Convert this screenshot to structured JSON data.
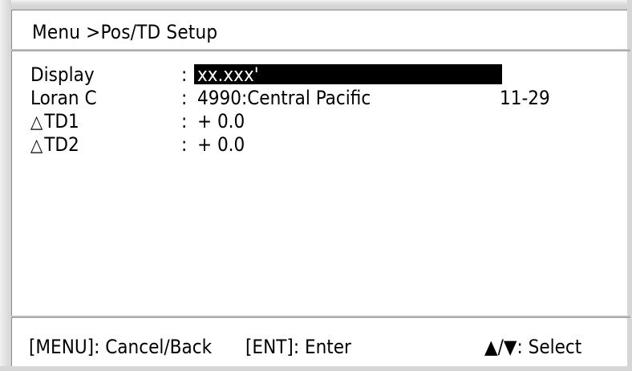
{
  "header": {
    "title": "Menu >Pos/TD Setup"
  },
  "settings": [
    {
      "label": "Display",
      "symbol": "",
      "value": "xx.xxx'",
      "extra": ""
    },
    {
      "label": "Loran C",
      "symbol": "",
      "value": "4990:Central Pacific",
      "extra": "11-29"
    },
    {
      "label": "TD1",
      "symbol": "△",
      "value": "+ 0.0",
      "extra": ""
    },
    {
      "label": "TD2",
      "symbol": "△",
      "value": "+ 0.0",
      "extra": ""
    }
  ],
  "separator": ":",
  "footer": {
    "menu_hint": "[MENU]: Cancel/Back",
    "enter_hint": "[ENT]: Enter",
    "select_hint": "▲/▼: Select"
  },
  "colors": {
    "background": "#ffffff",
    "text": "#000000",
    "selection_bg": "#000000",
    "selection_text": "#ffffff"
  }
}
